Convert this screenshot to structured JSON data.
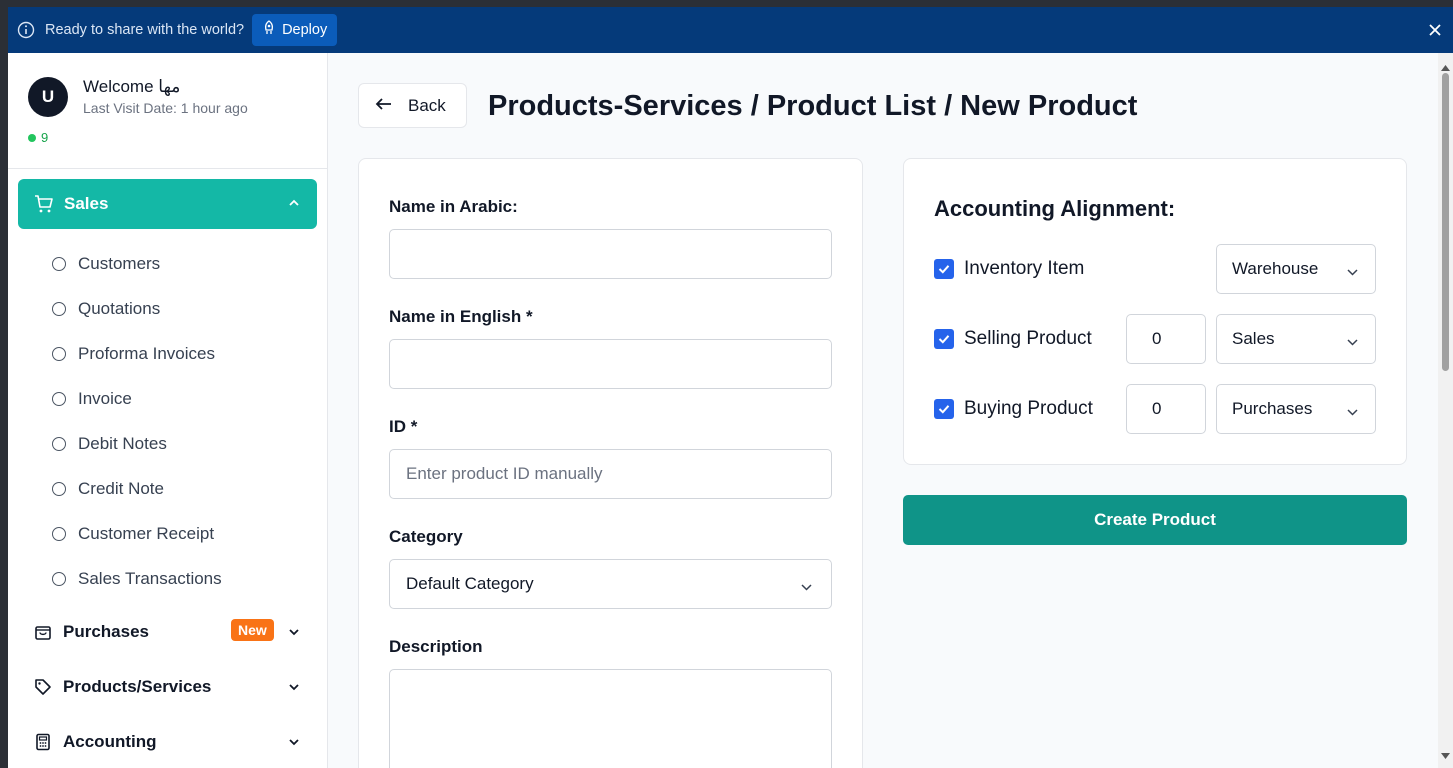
{
  "banner": {
    "message": "Ready to share with the world?",
    "deploy_label": "Deploy",
    "info_icon": "info-icon",
    "close_icon": "close-icon"
  },
  "sidebar": {
    "user": {
      "avatar_initial": "U",
      "welcome": "Welcome مها",
      "last_visit": "Last Visit Date: 1 hour ago",
      "online_count": "9"
    },
    "sales": {
      "label": "Sales",
      "icon": "cart-icon"
    },
    "sales_items": [
      {
        "label": "Customers"
      },
      {
        "label": "Quotations"
      },
      {
        "label": "Proforma Invoices"
      },
      {
        "label": "Invoice"
      },
      {
        "label": "Debit Notes"
      },
      {
        "label": "Credit Note"
      },
      {
        "label": "Customer Receipt"
      },
      {
        "label": "Sales Transactions"
      }
    ],
    "nav": [
      {
        "label": "Purchases",
        "icon": "shopping-bag-icon",
        "badge": "New"
      },
      {
        "label": "Products/Services",
        "icon": "tag-icon"
      },
      {
        "label": "Accounting",
        "icon": "calculator-icon"
      }
    ]
  },
  "main": {
    "back_label": "Back",
    "title": "Products-Services / Product List / New Product",
    "form": {
      "name_ar_label": "Name in Arabic:",
      "name_ar_value": "",
      "name_en_label": "Name in English *",
      "name_en_value": "",
      "id_label": "ID *",
      "id_placeholder": "Enter product ID manually",
      "category_label": "Category",
      "category_value": "Default Category",
      "description_label": "Description"
    },
    "accounting": {
      "title": "Accounting Alignment:",
      "rows": [
        {
          "label": "Inventory Item",
          "checked": true,
          "select": "Warehouse"
        },
        {
          "label": "Selling Product",
          "checked": true,
          "number": "0",
          "select": "Sales"
        },
        {
          "label": "Buying Product",
          "checked": true,
          "number": "0",
          "select": "Purchases"
        }
      ]
    },
    "create_label": "Create Product"
  },
  "colors": {
    "banner_bg": "#053a7a",
    "deploy_bg": "#0b5cba",
    "sales_active": "#14b8a6",
    "create_button": "#0f9488",
    "checkbox": "#2563eb",
    "new_badge": "#f97316"
  }
}
